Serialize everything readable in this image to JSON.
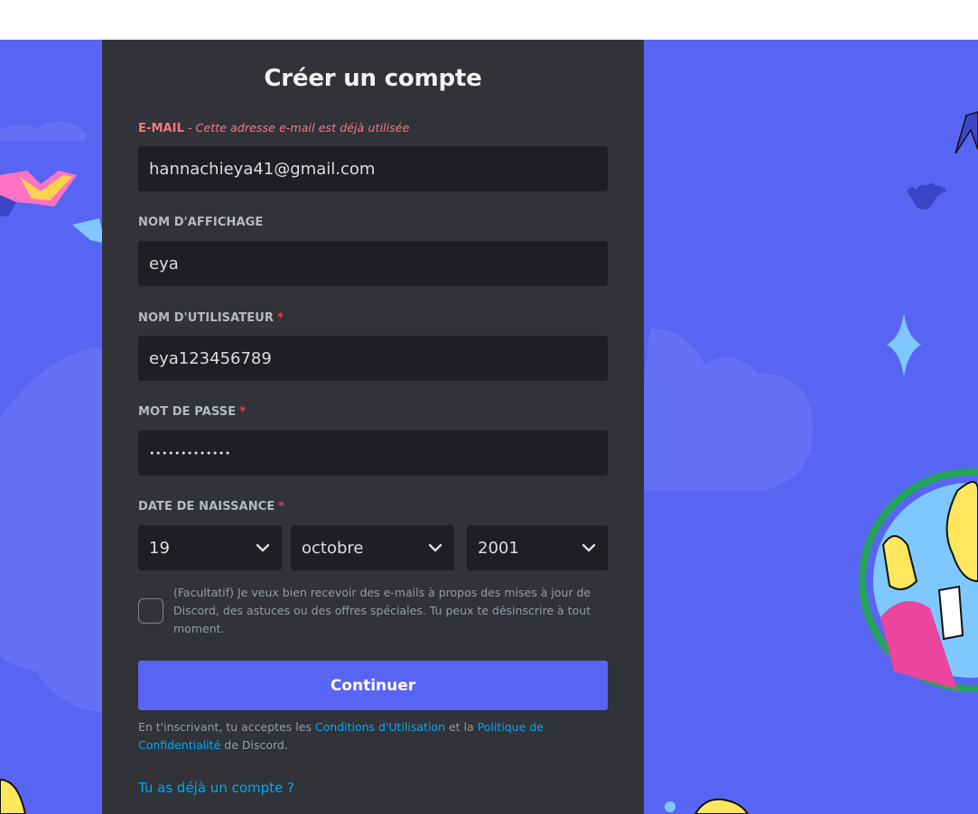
{
  "form": {
    "title": "Créer un compte",
    "email": {
      "label": "E-MAIL",
      "error": "- Cette adresse e-mail est déjà utilisée",
      "value": "hannachieya41@gmail.com"
    },
    "display_name": {
      "label": "NOM D'AFFICHAGE",
      "value": "eya"
    },
    "username": {
      "label": "NOM D'UTILISATEUR",
      "required_mark": "*",
      "value": "eya123456789"
    },
    "password": {
      "label": "MOT DE PASSE",
      "required_mark": "*",
      "value": "•••••••••••••"
    },
    "birthdate": {
      "label": "DATE DE NAISSANCE",
      "required_mark": "*",
      "day": "19",
      "month": "octobre",
      "year": "2001"
    },
    "marketing_optin": {
      "text": "(Facultatif) Je veux bien recevoir des e-mails à propos des mises à jour de Discord, des astuces ou des offres spéciales. Tu peux te désinscrire à tout moment.",
      "checked": false
    },
    "continue_label": "Continuer",
    "terms": {
      "prefix": "En t'inscrivant, tu acceptes les ",
      "tos_link": "Conditions d'Utilisation",
      "middle": " et la ",
      "privacy_link": "Politique de Confidentialité",
      "suffix": " de Discord."
    },
    "login_link": "Tu as déjà un compte ?"
  },
  "colors": {
    "brand": "#5865f2",
    "card": "#313338",
    "input": "#1e1f22",
    "error": "#fa777c",
    "link": "#00a8fc"
  }
}
